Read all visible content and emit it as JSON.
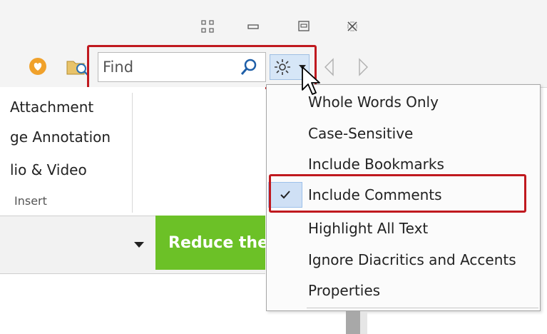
{
  "search": {
    "placeholder": "Find"
  },
  "ribbon": {
    "items": [
      "Attachment",
      "ge Annotation",
      "lio & Video"
    ],
    "group_label": "Insert"
  },
  "promo": {
    "text": "Reduce the"
  },
  "menu": {
    "items": [
      {
        "label": "Whole Words Only",
        "checked": false
      },
      {
        "label": "Case-Sensitive",
        "checked": false
      },
      {
        "label": "Include Bookmarks",
        "checked": false
      },
      {
        "label": "Include Comments",
        "checked": true
      },
      {
        "label": "Highlight All Text",
        "checked": false
      },
      {
        "label": "Ignore Diacritics and Accents",
        "checked": false
      },
      {
        "label": "Properties",
        "checked": false
      }
    ]
  },
  "icons": {
    "fullscreen": "fullscreen-icon",
    "minimize": "minimize-icon",
    "restore": "restore-icon",
    "close": "close-icon",
    "favorite": "heart-icon",
    "folder_search": "folder-search-icon",
    "search": "search-icon",
    "settings": "gear-icon",
    "dropdown": "caret-down-icon",
    "prev": "triangle-left-icon",
    "next": "triangle-right-icon",
    "check": "check-icon"
  },
  "colors": {
    "highlight": "#c0191f",
    "promo": "#6cc127",
    "checked_bg": "#cfe0f5"
  }
}
